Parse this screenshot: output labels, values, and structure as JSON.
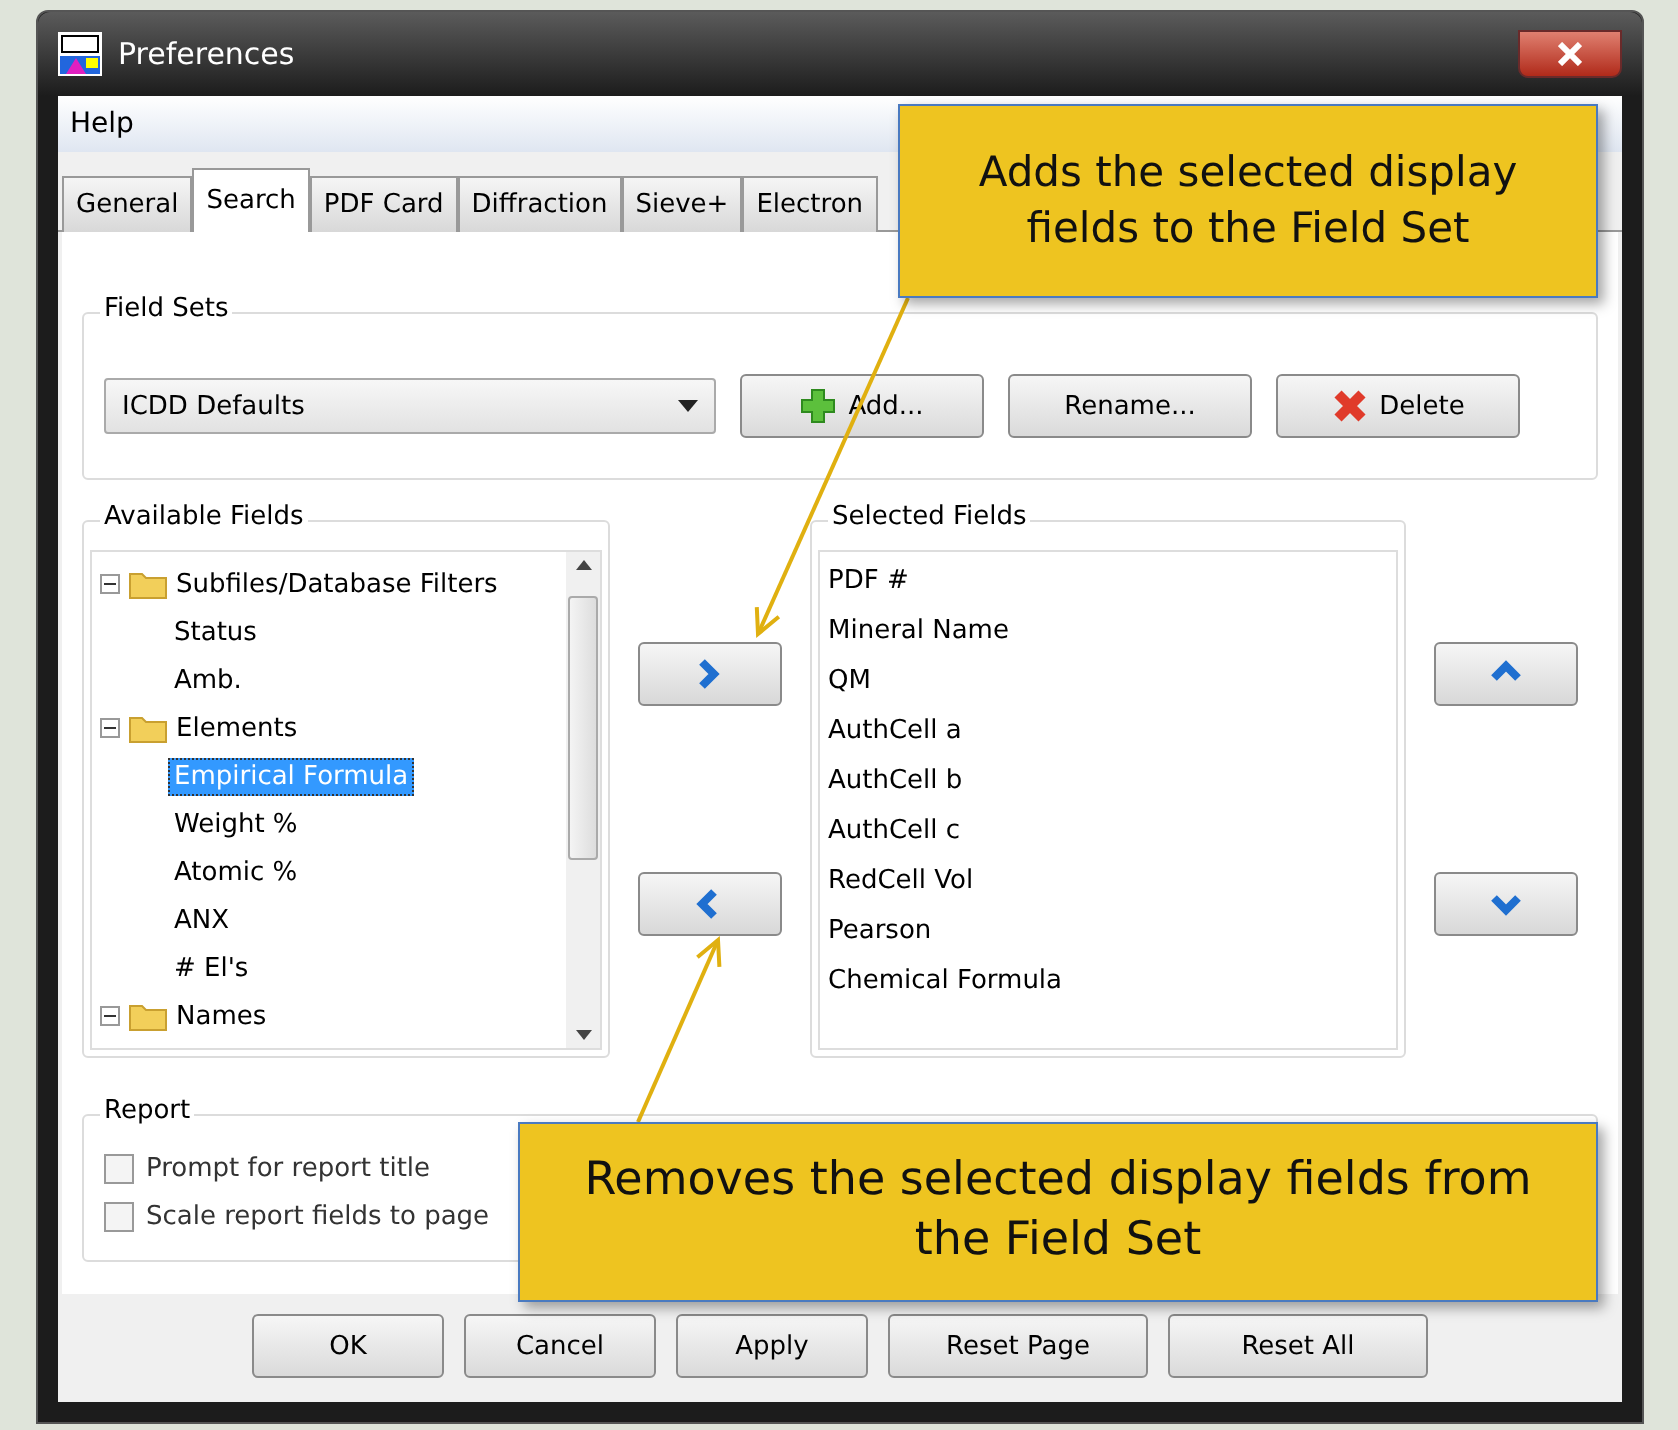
{
  "window": {
    "title": "Preferences"
  },
  "menu": [
    "Help"
  ],
  "tabs": [
    {
      "label": "General",
      "selected": false
    },
    {
      "label": "Search",
      "selected": true
    },
    {
      "label": "PDF Card",
      "selected": false
    },
    {
      "label": "Diffraction",
      "selected": false
    },
    {
      "label": "Sieve+",
      "selected": false
    },
    {
      "label": "Electron",
      "selected": false
    }
  ],
  "field_sets": {
    "title": "Field Sets",
    "value": "ICDD Defaults",
    "buttons": [
      {
        "label": "Add...",
        "kind": "add"
      },
      {
        "label": "Rename...",
        "kind": "plain"
      },
      {
        "label": "Delete",
        "kind": "delete"
      }
    ]
  },
  "available_fields": {
    "title": "Available Fields",
    "tree": [
      {
        "label": "Subfiles/Database Filters",
        "expanded": true,
        "children": [
          {
            "label": "Status",
            "selected": false
          },
          {
            "label": "Amb.",
            "selected": false
          }
        ]
      },
      {
        "label": "Elements",
        "expanded": true,
        "children": [
          {
            "label": "Empirical Formula",
            "selected": true
          },
          {
            "label": "Weight %",
            "selected": false
          },
          {
            "label": "Atomic %",
            "selected": false
          },
          {
            "label": "ANX",
            "selected": false
          },
          {
            "label": "# El's",
            "selected": false
          }
        ]
      },
      {
        "label": "Names",
        "expanded": true
      }
    ]
  },
  "selected_fields": {
    "title": "Selected Fields",
    "items": [
      "PDF #",
      "Mineral Name",
      "QM",
      "AuthCell a",
      "AuthCell b",
      "AuthCell c",
      "RedCell Vol",
      "Pearson",
      "Chemical Formula"
    ]
  },
  "report": {
    "title": "Report",
    "options": [
      {
        "label": "Prompt for report title",
        "checked": false
      },
      {
        "label": "Scale report fields to page",
        "checked": false
      }
    ]
  },
  "buttons": [
    "OK",
    "Cancel",
    "Apply",
    "Reset Page",
    "Reset All"
  ],
  "callouts": [
    {
      "text": "Adds the selected display fields to the Field Set",
      "kind": "add"
    },
    {
      "text": "Removes the selected display fields from the Field Set",
      "kind": "remove"
    }
  ]
}
